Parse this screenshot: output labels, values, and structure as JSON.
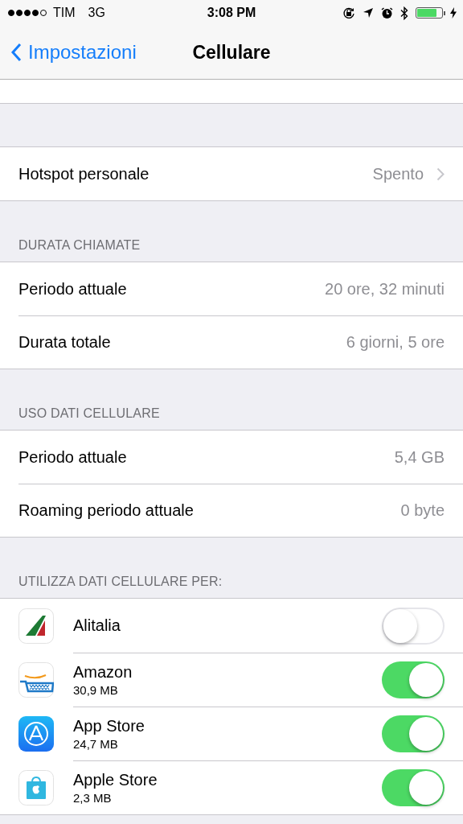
{
  "status_bar": {
    "carrier": "TIM",
    "network": "3G",
    "time": "3:08 PM",
    "charging": true
  },
  "nav": {
    "back_label": "Impostazioni",
    "title": "Cellulare"
  },
  "sections": [
    {
      "rows": [
        {
          "label": "Hotspot personale",
          "value": "Spento",
          "chevron": true
        }
      ]
    },
    {
      "header": "DURATA CHIAMATE",
      "rows": [
        {
          "label": "Periodo attuale",
          "value": "20 ore, 32 minuti",
          "chevron": false
        },
        {
          "label": "Durata totale",
          "value": "6 giorni, 5 ore",
          "chevron": false
        }
      ]
    },
    {
      "header": "USO DATI CELLULARE",
      "rows": [
        {
          "label": "Periodo attuale",
          "value": "5,4 GB",
          "chevron": false
        },
        {
          "label": "Roaming periodo attuale",
          "value": "0 byte",
          "chevron": false
        }
      ]
    }
  ],
  "apps_header": "UTILIZZA DATI CELLULARE PER:",
  "apps": [
    {
      "kind": "airline",
      "name": "Alitalia",
      "on": false
    },
    {
      "kind": "shop",
      "name": "Amazon",
      "usage": "30,9 MB",
      "on": true
    },
    {
      "kind": "appstore",
      "name": "App Store",
      "usage": "24,7 MB",
      "on": true
    },
    {
      "kind": "bag",
      "name": "Apple Store",
      "usage": "2,3 MB",
      "on": true
    }
  ]
}
